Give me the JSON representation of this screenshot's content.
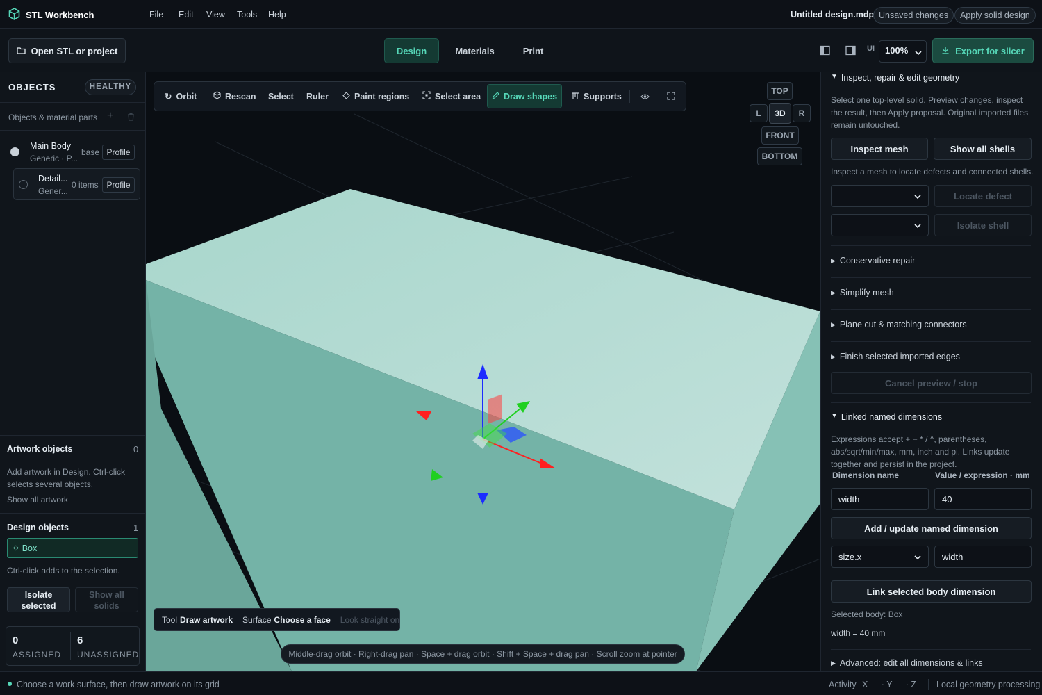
{
  "app": {
    "name": "STL Workbench",
    "menus": [
      "File",
      "Edit",
      "View",
      "Tools",
      "Help"
    ],
    "doc_name": "Untitled design.mdp",
    "unsaved": "Unsaved changes",
    "apply_solid": "Apply solid design"
  },
  "toolbar": {
    "open": "Open STL or project",
    "tabs": [
      "Design",
      "Materials",
      "Print"
    ],
    "ui_label": "UI",
    "zoom": "100%",
    "export": "Export for slicer"
  },
  "left": {
    "objects_title": "OBJECTS",
    "health": "HEALTHY",
    "subtitle": "Objects & material parts",
    "items": [
      {
        "name": "Main Body",
        "sub": "Generic · P...",
        "tag": "base",
        "profile": "Profile"
      },
      {
        "name": "Detail...",
        "sub": "Gener...",
        "tag": "0 items",
        "profile": "Profile"
      }
    ],
    "artwork_title": "Artwork objects",
    "artwork_count": "0",
    "artwork_help": "Add artwork in Design. Ctrl-click selects several objects.",
    "show_all_artwork": "Show all artwork",
    "design_title": "Design objects",
    "design_count": "1",
    "design_item": "Box",
    "ctrl_help": "Ctrl-click adds to the selection.",
    "isolate_line1": "Isolate",
    "isolate_line2": "selected",
    "show_all_line1": "Show all",
    "show_all_line2": "solids",
    "assigned_num": "0",
    "assigned_label": "ASSIGNED",
    "unassigned_num": "6",
    "unassigned_label": "UNASSIGNED"
  },
  "viewport": {
    "tools": [
      "Orbit",
      "Rescan",
      "Select",
      "Ruler",
      "Paint regions",
      "Select area",
      "Draw shapes",
      "Supports"
    ],
    "views": {
      "top": "TOP",
      "l": "L",
      "3d": "3D",
      "r": "R",
      "front": "FRONT",
      "bottom": "BOTTOM"
    },
    "tool_label": "Tool",
    "tool_value": "Draw artwork",
    "surface_label": "Surface",
    "surface_value": "Choose a face",
    "look": "Look straight on",
    "hint": "Middle-drag orbit · Right-drag pan · Space + drag orbit · Shift + Space + drag pan · Scroll zoom at pointer"
  },
  "right": {
    "inspect_title": "Inspect, repair & edit geometry",
    "inspect_desc": "Select one top-level solid. Preview changes, inspect the result, then Apply proposal. Original imported files remain untouched.",
    "inspect_mesh": "Inspect mesh",
    "show_shells": "Show all shells",
    "inspect_help": "Inspect a mesh to locate defects and connected shells.",
    "locate_defect": "Locate defect",
    "isolate_shell": "Isolate shell",
    "sections": [
      "Conservative repair",
      "Simplify mesh",
      "Plane cut & matching connectors",
      "Finish selected imported edges"
    ],
    "cancel_preview": "Cancel preview / stop",
    "linked_title": "Linked named dimensions",
    "linked_desc": "Expressions accept + − * / ^, parentheses, abs/sqrt/min/max, mm, inch and pi. Links update together and persist in the project.",
    "col_name": "Dimension name",
    "col_value": "Value / expression · mm",
    "dim_name": "width",
    "dim_value": "40",
    "add_update": "Add / update named dimension",
    "link_select": "size.x",
    "link_value": "width",
    "link_btn": "Link selected body dimension",
    "selected_body": "Selected body: Box",
    "width_eq": "width = 40 mm",
    "advanced": "Advanced: edit all dimensions & links"
  },
  "status": {
    "message": "Choose a work surface, then draw artwork on its grid",
    "activity": "Activity",
    "axes": "X — · Y — · Z —",
    "local": "Local geometry processing"
  },
  "colors": {
    "accent": "#56d7b8",
    "box_top": "#aed8d0",
    "box_side": "#74b3a7",
    "axis_x": "#ff2020",
    "axis_y": "#20d020",
    "axis_z": "#1c2cff"
  }
}
